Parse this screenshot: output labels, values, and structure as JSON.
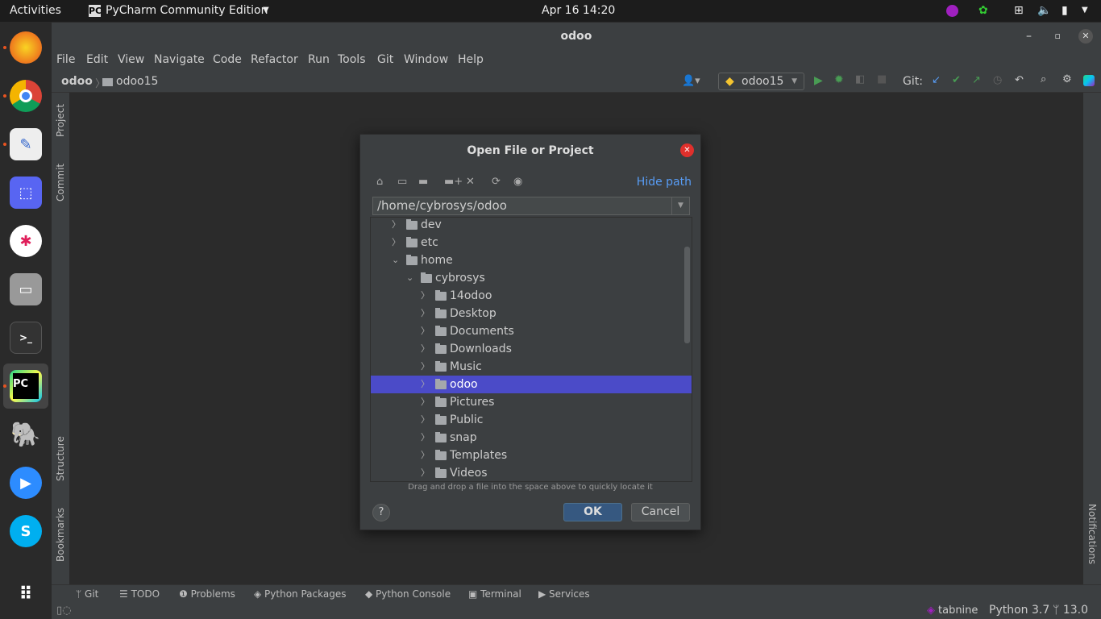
{
  "topbar": {
    "activities": "Activities",
    "app": "PyCharm Community Edition",
    "clock": "Apr 16  14:20"
  },
  "window": {
    "title": "odoo"
  },
  "menu": [
    "File",
    "Edit",
    "View",
    "Navigate",
    "Code",
    "Refactor",
    "Run",
    "Tools",
    "Git",
    "Window",
    "Help"
  ],
  "breadcrumb": [
    "odoo",
    "odoo15"
  ],
  "toolbar": {
    "run_config": "odoo15",
    "git_label": "Git:"
  },
  "left_strip": [
    "Project",
    "Commit",
    "Structure",
    "Bookmarks"
  ],
  "right_strip": [
    "Notifications"
  ],
  "dialog": {
    "title": "Open File or Project",
    "hide_path": "Hide path",
    "path": "/home/cybrosys/odoo",
    "tree": [
      {
        "label": "dev",
        "level": 0,
        "expanded": false
      },
      {
        "label": "etc",
        "level": 0,
        "expanded": false
      },
      {
        "label": "home",
        "level": 0,
        "expanded": true
      },
      {
        "label": "cybrosys",
        "level": 1,
        "expanded": true
      },
      {
        "label": "14odoo",
        "level": 2
      },
      {
        "label": "Desktop",
        "level": 2
      },
      {
        "label": "Documents",
        "level": 2
      },
      {
        "label": "Downloads",
        "level": 2
      },
      {
        "label": "Music",
        "level": 2
      },
      {
        "label": "odoo",
        "level": 2,
        "selected": true
      },
      {
        "label": "Pictures",
        "level": 2
      },
      {
        "label": "Public",
        "level": 2
      },
      {
        "label": "snap",
        "level": 2
      },
      {
        "label": "Templates",
        "level": 2
      },
      {
        "label": "Videos",
        "level": 2
      }
    ],
    "hint": "Drag and drop a file into the space above to quickly locate it",
    "ok": "OK",
    "cancel": "Cancel",
    "help": "?"
  },
  "tool_windows": [
    "Git",
    "TODO",
    "Problems",
    "Python Packages",
    "Python Console",
    "Terminal",
    "Services"
  ],
  "status": {
    "tabnine": "tabnine",
    "interpreter": "Python 3.7",
    "branch": "13.0"
  },
  "colors": {
    "selection": "#4b4bc8",
    "link": "#589df6",
    "run": "#499c54"
  }
}
